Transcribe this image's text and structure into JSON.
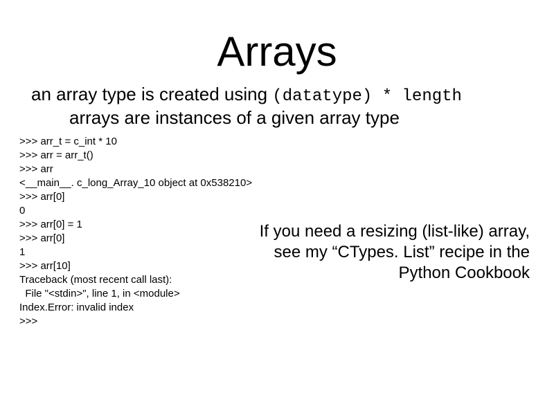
{
  "title": "Arrays",
  "subtitle1_pre": "an array type is created using ",
  "subtitle1_mono": "(datatype) * length",
  "subtitle2": "arrays are instances of a given array type",
  "code_lines": [
    ">>> arr_t = c_int * 10",
    ">>> arr = arr_t()",
    ">>> arr",
    "<__main__. c_long_Array_10 object at 0x538210>",
    ">>> arr[0]",
    "0",
    ">>> arr[0] = 1",
    ">>> arr[0]",
    "1",
    ">>> arr[10]",
    "Traceback (most recent call last):",
    "  File \"<stdin>\", line 1, in <module>",
    "Index.Error: invalid index",
    ">>>"
  ],
  "note_line1": "If you need a resizing (list-like) array,",
  "note_line2": "see my “CTypes. List” recipe in the Python Cookbook"
}
